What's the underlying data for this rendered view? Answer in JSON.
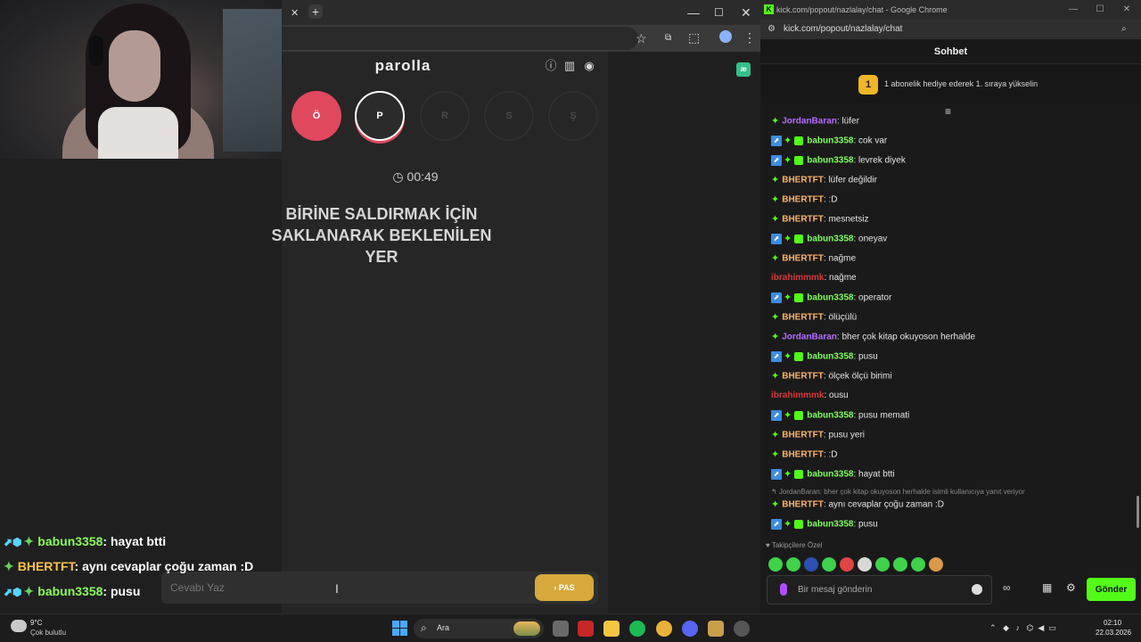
{
  "game": {
    "title": "parolla",
    "letters": [
      "Ö",
      "P",
      "R",
      "S",
      "Ş"
    ],
    "timer": "00:49",
    "question": "BİRİNE SALDIRMAK İÇİN SAKLANARAK BEKLENİLEN YER",
    "answer_placeholder": "Cevabı Yaz",
    "pass_label": "PAS",
    "colors": {
      "active_letter": "#e0485e",
      "pass_button": "#d6a93a"
    }
  },
  "overlay_chat": [
    {
      "user": "babun3358",
      "text": ": hayat btti"
    },
    {
      "user": "BHERTFT",
      "text": ": aynı cevaplar çoğu zaman :D"
    },
    {
      "user": "babun3358",
      "text": ": pusu"
    }
  ],
  "chat_window": {
    "title": "kick.com/popout/nazlalay/chat - Google Chrome",
    "url": "kick.com/popout/nazlalay/chat",
    "header": "Sohbet",
    "sub_badge": "1",
    "sub_banner": "1 abonelik hediye ederek 1. sıraya yükselin",
    "messages": [
      {
        "user": "JordanBaran",
        "text": ": lüfer",
        "style": "purple",
        "badges": "green"
      },
      {
        "user": "babun3358",
        "text": ": cok var",
        "style": "green",
        "badges": "full"
      },
      {
        "user": "babun3358",
        "text": ": levrek diyek",
        "style": "green",
        "badges": "full"
      },
      {
        "user": "BHERTFT",
        "text": ": lüfer değildir",
        "style": "orange",
        "badges": "green"
      },
      {
        "user": "BHERTFT",
        "text": ": :D",
        "style": "orange",
        "badges": "green"
      },
      {
        "user": "BHERTFT",
        "text": ": mesnetsiz",
        "style": "orange",
        "badges": "green"
      },
      {
        "user": "babun3358",
        "text": ": oneyav",
        "style": "green",
        "badges": "full"
      },
      {
        "user": "BHERTFT",
        "text": ": nağme",
        "style": "orange",
        "badges": "green"
      },
      {
        "user": "ibrahimmmk",
        "text": ": nağme",
        "style": "red",
        "badges": "none"
      },
      {
        "user": "babun3358",
        "text": ": operator",
        "style": "green",
        "badges": "full"
      },
      {
        "user": "BHERTFT",
        "text": ": ölüçülü",
        "style": "orange",
        "badges": "green"
      },
      {
        "user": "JordanBaran",
        "text": ": bher çok kitap okuyoson herhalde",
        "style": "purple",
        "badges": "green"
      },
      {
        "user": "babun3358",
        "text": ": pusu",
        "style": "green",
        "badges": "full"
      },
      {
        "user": "BHERTFT",
        "text": ": ölçek ölçü birimi",
        "style": "orange",
        "badges": "green"
      },
      {
        "user": "ibrahimmmk",
        "text": ": ousu",
        "style": "red",
        "badges": "none"
      },
      {
        "user": "babun3358",
        "text": ": pusu memati",
        "style": "green",
        "badges": "full"
      },
      {
        "user": "BHERTFT",
        "text": ": pusu yeri",
        "style": "orange",
        "badges": "green"
      },
      {
        "user": "BHERTFT",
        "text": ": :D",
        "style": "orange",
        "badges": "green"
      },
      {
        "user": "babun3358",
        "text": ": hayat btti",
        "style": "green",
        "badges": "full"
      }
    ],
    "reply_note": "JordanBaran: bher çok kitap okuyoson herhalde isimli kullanıcıya yanıt veriyor",
    "reply_message": {
      "user": "BHERTFT",
      "text": ": aynı cevaplar çoğu zaman :D"
    },
    "last_message": {
      "user": "babun3358",
      "text": ": pusu"
    },
    "follower_note": "Takipçilere Özel",
    "input_placeholder": "Bir mesaj gönderin",
    "send_label": "Gönder",
    "colors": {
      "kick_green": "#53fc18",
      "purple_user": "#b86bff",
      "orange_user": "#ffb46a",
      "red_user": "#d43a3a"
    }
  },
  "taskbar": {
    "weather_temp": "9°C",
    "weather_desc": "Çok bulutlu",
    "search_label": "Ara",
    "time": "02:10",
    "date": "22.03.2026"
  }
}
